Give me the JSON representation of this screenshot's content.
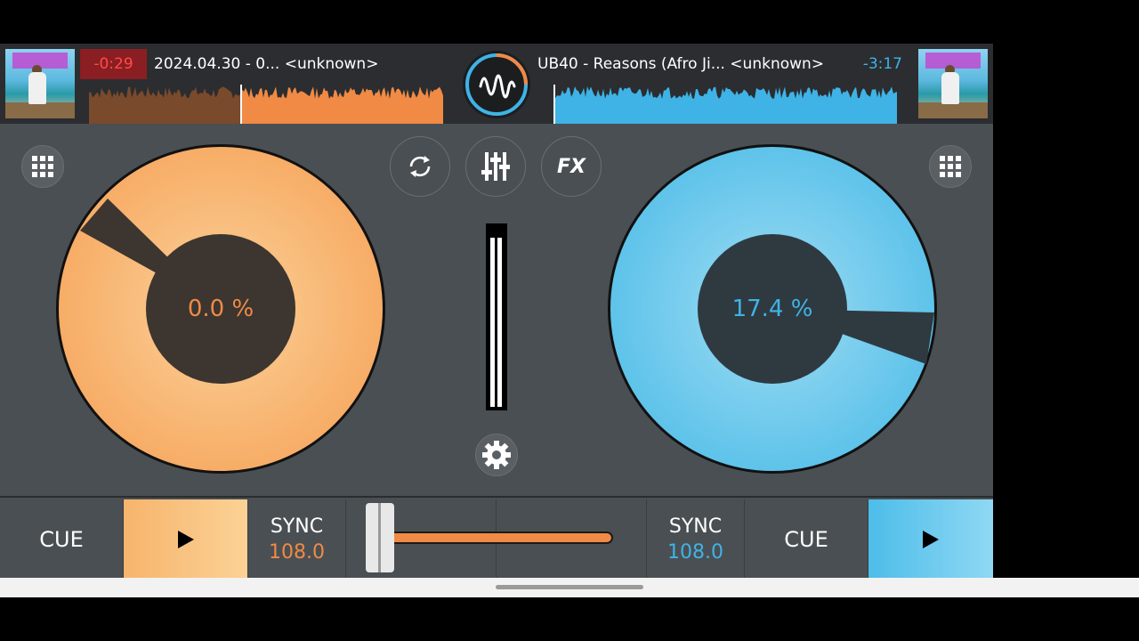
{
  "deck_left": {
    "time": "-0:29",
    "title": "2024.04.30 - 0...  <unknown>",
    "pitch": "0.0 %",
    "cue_label": "CUE",
    "sync_label": "SYNC",
    "bpm": "108.0",
    "color": "#f59a4a"
  },
  "deck_right": {
    "time": "-3:17",
    "title": "UB40 - Reasons (Afro Ji...  <unknown>",
    "pitch": "17.4 %",
    "cue_label": "CUE",
    "sync_label": "SYNC",
    "bpm": "108.0",
    "color": "#3fb3e6"
  },
  "mixer": {
    "fx_label": "FX",
    "crossfader_position": 0.0
  },
  "icons": [
    "app-logo-icon",
    "grid-icon",
    "loop-icon",
    "mixer-sliders-icon",
    "fx-icon",
    "settings-gear-icon",
    "play-icon"
  ]
}
